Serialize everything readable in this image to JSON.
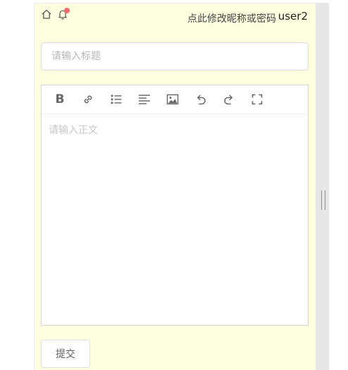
{
  "header": {
    "home_icon": "home-icon",
    "notification_icon": "bell-icon",
    "notification_badge_color": "#f56c6c",
    "edit_profile_link": "点此修改昵称或密码",
    "username": "user2"
  },
  "post_form": {
    "title_placeholder": "请输入标题",
    "title_value": "",
    "body_placeholder": "请输入正文",
    "toolbar": [
      {
        "icon": "bold-icon",
        "glyph": "B"
      },
      {
        "icon": "link-icon"
      },
      {
        "icon": "bulleted-list-icon"
      },
      {
        "icon": "align-left-icon"
      },
      {
        "icon": "image-icon"
      },
      {
        "icon": "undo-icon"
      },
      {
        "icon": "redo-icon"
      },
      {
        "icon": "fullscreen-icon"
      }
    ],
    "submit_label": "提交"
  },
  "colors": {
    "panel_background": "#ffffdf",
    "scroll_rail": "#e7e7e7"
  }
}
